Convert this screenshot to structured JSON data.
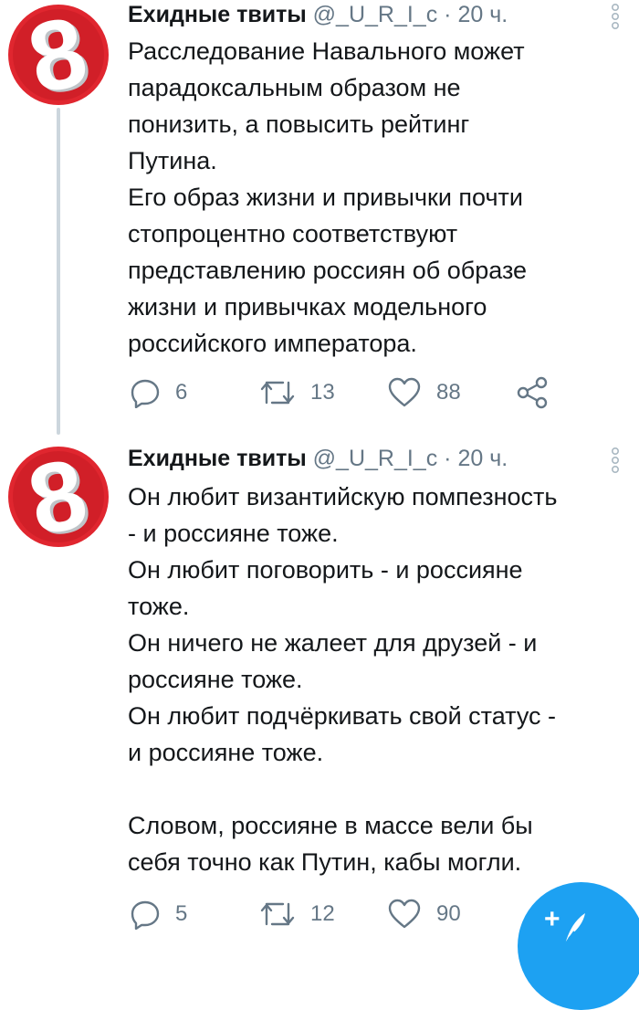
{
  "tweets": [
    {
      "author": "Ехидные твиты",
      "handle": "@_U_R_I_c",
      "separator": "·",
      "time": "20 ч.",
      "lines": [
        "Расследование Навального может",
        "парадоксальным образом не",
        "понизить, а повысить рейтинг",
        "Путина.",
        "Его образ жизни и привычки почти",
        "стопроцентно соответствуют",
        "представлению россиян об образе",
        "жизни и привычках модельного",
        "российского императора."
      ],
      "replies": "6",
      "retweets": "13",
      "likes": "88"
    },
    {
      "author": "Ехидные твиты",
      "handle": "@_U_R_I_c",
      "separator": "·",
      "time": "20 ч.",
      "lines": [
        "Он любит византийскую помпезность",
        "- и россияне тоже.",
        "Он любит поговорить - и россияне",
        "тоже.",
        "Он ничего не жалеет для друзей - и",
        "россияне тоже.",
        "Он любит подчёркивать свой статус -",
        "и россияне тоже.",
        "",
        "Словом, россияне в массе вели бы",
        "себя точно как Путин, кабы могли."
      ],
      "replies": "5",
      "retweets": "12",
      "likes": "90"
    }
  ],
  "avatar": {
    "glyph": "8",
    "color": "#e0262f"
  },
  "compose": {
    "plus": "+"
  },
  "colors": {
    "accent": "#1da1f2",
    "secondary": "#657786",
    "thread": "#ccd6dd"
  }
}
